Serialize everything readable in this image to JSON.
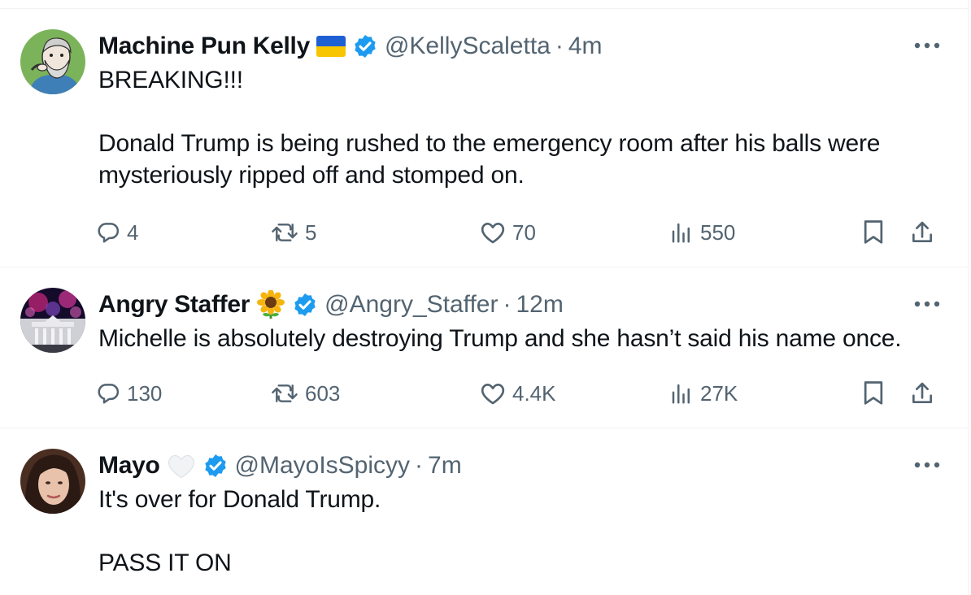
{
  "tweets": [
    {
      "name": "Machine Pun Kelly",
      "badge_emoji": "ukraine-flag",
      "handle": "@KellyScaletta",
      "dot": "·",
      "time": "4m",
      "text": "BREAKING!!!\n\nDonald Trump is being rushed to the emergency room after his balls were mysteriously ripped off and stomped on.",
      "replies": "4",
      "reposts": "5",
      "likes": "70",
      "views": "550"
    },
    {
      "name": "Angry Staffer",
      "badge_emoji": "sunflower",
      "handle": "@Angry_Staffer",
      "dot": "·",
      "time": "12m",
      "text": "Michelle is absolutely destroying Trump and she hasn’t said his name once.",
      "replies": "130",
      "reposts": "603",
      "likes": "4.4K",
      "views": "27K"
    },
    {
      "name": "Mayo",
      "badge_emoji": "white-heart",
      "handle": "@MayoIsSpicyy",
      "dot": "·",
      "time": "7m",
      "text": "It's over for Donald Trump.\n\nPASS IT ON"
    }
  ],
  "colors": {
    "text": "#0f1419",
    "secondary": "#536471",
    "verified_blue": "#1d9bf0",
    "divider": "#eff3f4"
  },
  "icons": [
    "reply-icon",
    "repost-icon",
    "like-icon",
    "views-icon",
    "bookmark-icon",
    "share-icon",
    "more-icon",
    "verified-badge-icon"
  ]
}
